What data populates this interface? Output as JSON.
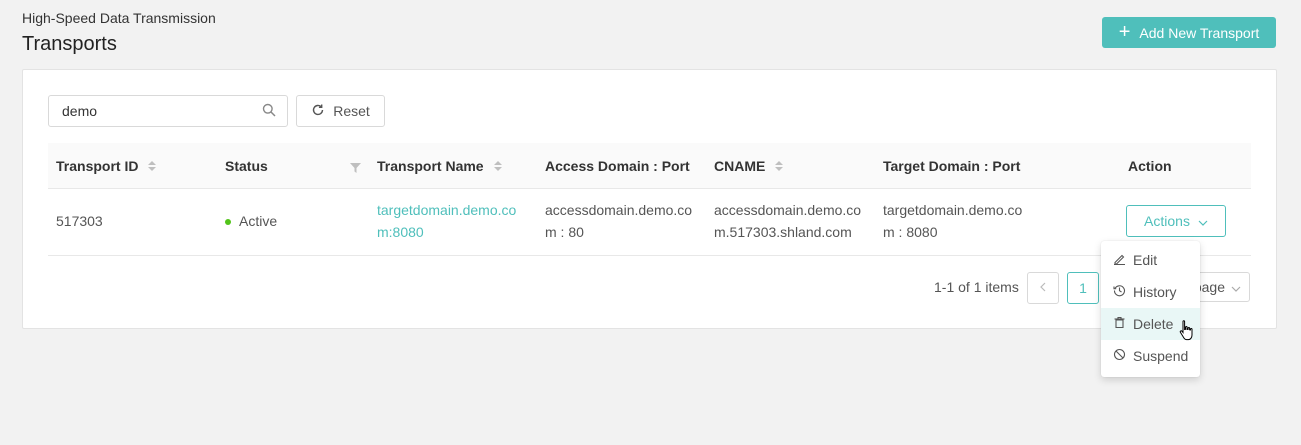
{
  "header": {
    "breadcrumb": "High-Speed Data Transmission",
    "title": "Transports",
    "add_button_label": "Add New Transport"
  },
  "toolbar": {
    "search_value": "demo",
    "reset_label": "Reset"
  },
  "table": {
    "columns": [
      "Transport ID",
      "Status",
      "Transport Name",
      "Access Domain : Port",
      "CNAME",
      "Target Domain : Port",
      "Action"
    ],
    "rows": [
      {
        "transport_id": "517303",
        "status": "Active",
        "transport_name": "targetdomain.demo.com:8080",
        "access_domain_port": "accessdomain.demo.com : 80",
        "cname": "accessdomain.demo.com.517303.shland.com",
        "target_domain_port": "targetdomain.demo.com : 8080",
        "action_label": "Actions"
      }
    ]
  },
  "pagination": {
    "total_text": "1-1 of 1 items",
    "current_page": "1",
    "page_size_label": "page"
  },
  "action_menu": {
    "items": [
      "Edit",
      "History",
      "Delete",
      "Suspend"
    ],
    "hovered": "Delete"
  },
  "colors": {
    "accent": "#4fbfbb",
    "status_active": "#52c41a",
    "background": "#f2f2f2"
  },
  "icons": [
    "plus-icon",
    "search-icon",
    "reset-icon",
    "sort-icon",
    "filter-icon",
    "chevron-down-icon",
    "chevron-left-icon",
    "edit-icon",
    "history-icon",
    "trash-icon",
    "suspend-icon",
    "hand-cursor-icon"
  ]
}
